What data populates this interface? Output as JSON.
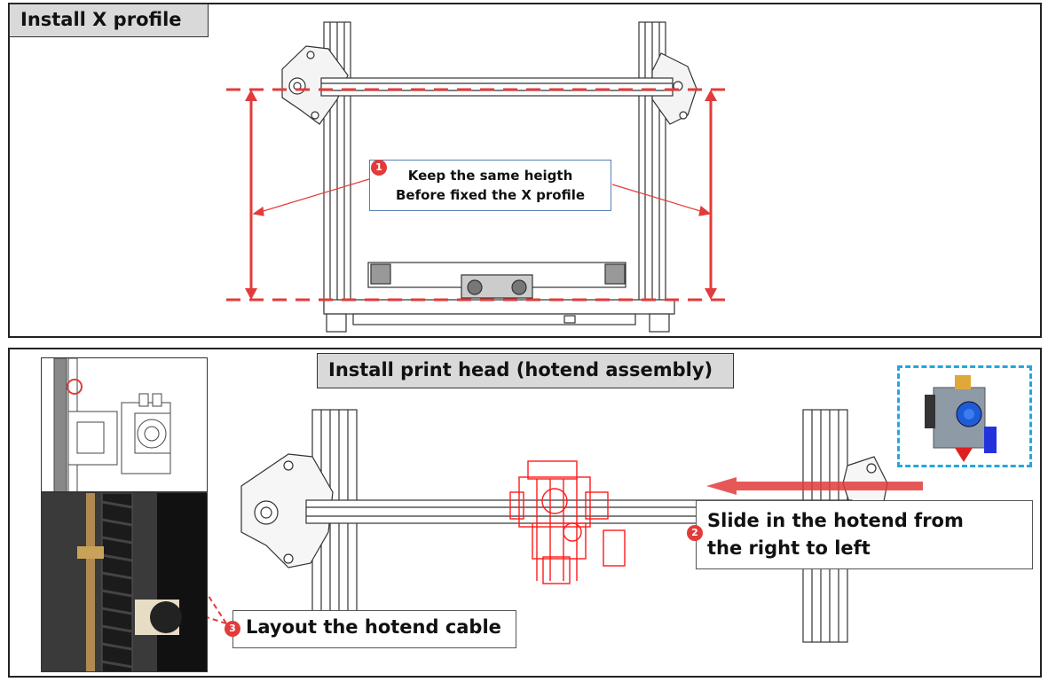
{
  "top_panel": {
    "title": "Install X profile",
    "step1_badge": "1",
    "callout_line1": "Keep the same heigth",
    "callout_line2": "Before fixed the X profile"
  },
  "bottom_panel": {
    "title": "Install print head (hotend assembly)",
    "step2_badge": "2",
    "callout2_line1": "Slide in the hotend from",
    "callout2_line2": "the right to left",
    "step3_badge": "3",
    "callout3": "Layout the hotend cable"
  },
  "colors": {
    "accent_red": "#e23b3b",
    "dashed_blue": "#22a7e0",
    "title_gray": "#d9d9d9"
  }
}
